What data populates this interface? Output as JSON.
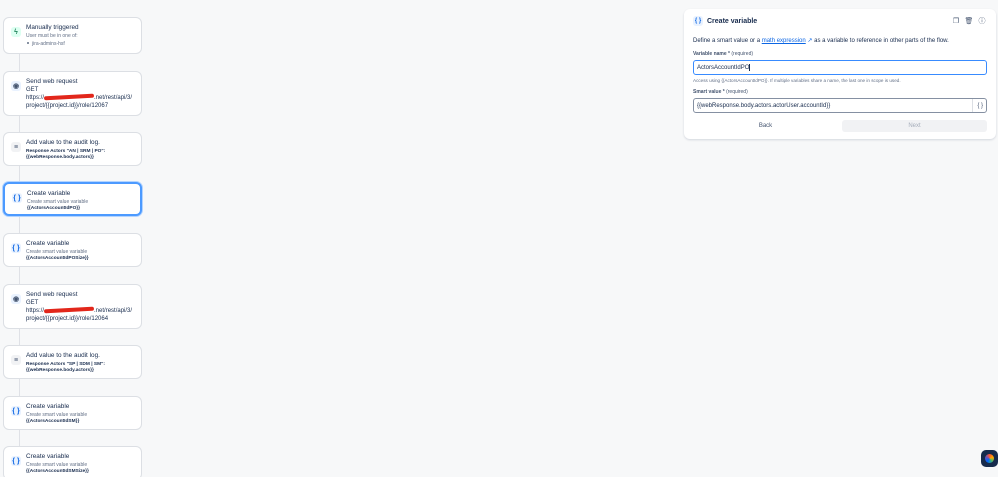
{
  "flow": {
    "trigger": {
      "title": "Manually triggered",
      "subtitle": "User must be in one of:",
      "group": "jira-admins-hsf"
    },
    "web1": {
      "title": "Send web request",
      "method": "GET",
      "url_prefix": "https://",
      "url_suffix": ".net/rest/api/3/",
      "url_line2": "project/{{project.id}}/role/12067"
    },
    "audit1": {
      "title": "Add value to the audit log.",
      "line1": "Response Actors \"AN | SRM | PO\":",
      "line2": "{{webResponse.body.actors}}"
    },
    "var1": {
      "title": "Create variable",
      "subtitle": "Create smart value variable",
      "value": "{{ActorsAccountIdPO}}"
    },
    "var2": {
      "title": "Create variable",
      "subtitle": "Create smart value variable",
      "value": "{{ActorsAccountIdPOSize}}"
    },
    "web2": {
      "title": "Send web request",
      "method": "GET",
      "url_prefix": "https://",
      "url_suffix": ".net/rest/api/3/",
      "url_line2": "project/{{project.id}}/role/12064"
    },
    "audit2": {
      "title": "Add value to the audit log.",
      "line1": "Response Actors \"SP | SDM | SM\":",
      "line2": "{{webResponse.body.actors}}"
    },
    "var3": {
      "title": "Create variable",
      "subtitle": "Create smart value variable",
      "value": "{{ActorsAccountIdSM}}"
    },
    "var4": {
      "title": "Create variable",
      "subtitle": "Create smart value variable",
      "value": "{{ActorsAccountIdSMSize}}"
    }
  },
  "panel": {
    "title": "Create variable",
    "desc_before": "Define a smart value or a ",
    "desc_link": "math expression",
    "desc_after": " as a variable to reference in other parts of the flow.",
    "name_label": "Variable name *",
    "required": "(required)",
    "name_value": "ActorsAccountIdPO",
    "help": "Access using {{ActorsAccountIdPO}}. If multiple variables share a name, the last one in scope is used.",
    "smart_label": "Smart value *",
    "smart_value": "{{webResponse.body.actors.actorUser.accountId}}",
    "back": "Back",
    "next": "Next"
  },
  "colors": {
    "accent": "#0c66e4",
    "focus_border": "#388bff",
    "selected_border": "#4c9aff",
    "redaction": "#e2271b"
  }
}
